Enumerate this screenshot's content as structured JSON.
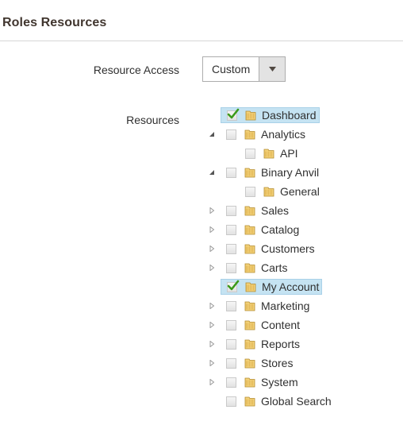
{
  "section": {
    "title": "Roles Resources"
  },
  "resource_access": {
    "label": "Resource Access",
    "selected_value": "Custom",
    "arrow_icon": "triangle-down-icon"
  },
  "resources": {
    "label": "Resources",
    "tree": [
      {
        "label": "Dashboard",
        "checked": true,
        "selected": true,
        "toggle": "none",
        "depth": 0
      },
      {
        "label": "Analytics",
        "checked": false,
        "toggle": "expanded",
        "depth": 0
      },
      {
        "label": "API",
        "checked": false,
        "toggle": "none",
        "depth": 1
      },
      {
        "label": "Binary Anvil",
        "checked": false,
        "toggle": "expanded",
        "depth": 0
      },
      {
        "label": "General",
        "checked": false,
        "toggle": "none",
        "depth": 1
      },
      {
        "label": "Sales",
        "checked": false,
        "toggle": "collapsed",
        "depth": 0
      },
      {
        "label": "Catalog",
        "checked": false,
        "toggle": "collapsed",
        "depth": 0
      },
      {
        "label": "Customers",
        "checked": false,
        "toggle": "collapsed",
        "depth": 0
      },
      {
        "label": "Carts",
        "checked": false,
        "toggle": "collapsed",
        "depth": 0
      },
      {
        "label": "My Account",
        "checked": true,
        "selected": true,
        "toggle": "none",
        "depth": 0
      },
      {
        "label": "Marketing",
        "checked": false,
        "toggle": "collapsed",
        "depth": 0
      },
      {
        "label": "Content",
        "checked": false,
        "toggle": "collapsed",
        "depth": 0
      },
      {
        "label": "Reports",
        "checked": false,
        "toggle": "collapsed",
        "depth": 0
      },
      {
        "label": "Stores",
        "checked": false,
        "toggle": "collapsed",
        "depth": 0
      },
      {
        "label": "System",
        "checked": false,
        "toggle": "collapsed",
        "depth": 0
      },
      {
        "label": "Global Search",
        "checked": false,
        "toggle": "none",
        "depth": 0
      }
    ]
  },
  "colors": {
    "selected_bg": "#c5e3f2",
    "check_green": "#3a9a1a",
    "folder_fill": "#f3d27a"
  }
}
